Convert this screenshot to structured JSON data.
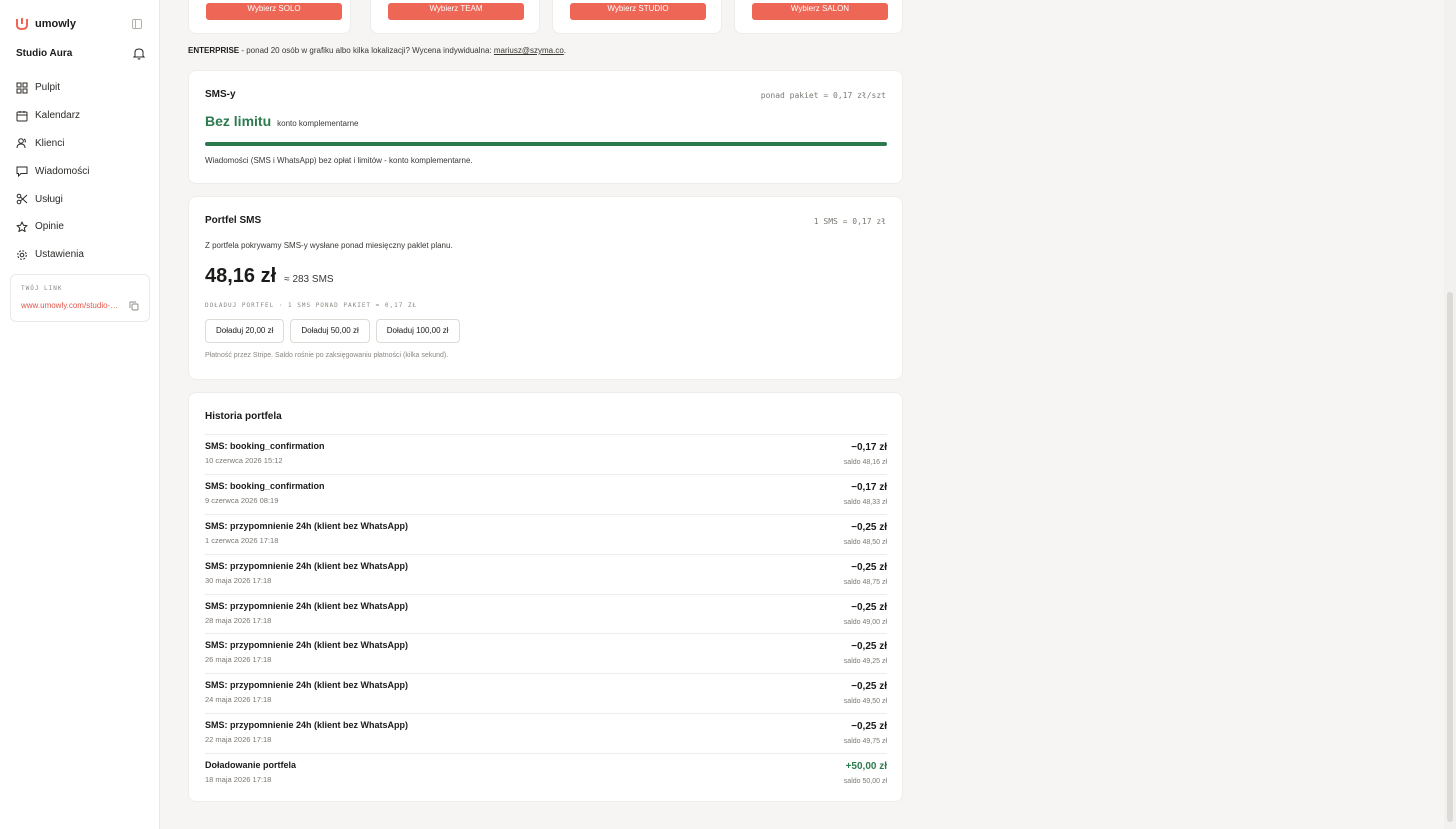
{
  "app": {
    "name": "umowly",
    "studio": "Studio Aura",
    "accent": "#ee6655",
    "success": "#2d7a4f"
  },
  "sidebar": {
    "items": [
      {
        "label": "Pulpit",
        "icon": "grid-icon"
      },
      {
        "label": "Kalendarz",
        "icon": "calendar-icon"
      },
      {
        "label": "Klienci",
        "icon": "users-icon"
      },
      {
        "label": "Wiadomości",
        "icon": "message-icon"
      },
      {
        "label": "Usługi",
        "icon": "scissors-icon"
      },
      {
        "label": "Opinie",
        "icon": "star-icon"
      },
      {
        "label": "Ustawienia",
        "icon": "gear-icon"
      }
    ],
    "link": {
      "label": "TWÓJ LINK",
      "url": "www.umowly.com/studio-aura"
    }
  },
  "plans": [
    "Wybierz SOLO",
    "Wybierz TEAM",
    "Wybierz STUDIO",
    "Wybierz SALON"
  ],
  "enterprise": {
    "label": "ENTERPRISE",
    "text": " - ponad 20 osób w grafiku albo kilka lokalizacji? Wycena indywidualna: ",
    "email": "mariusz@szyma.co",
    "end": "."
  },
  "sms": {
    "title": "SMS-y",
    "note": "ponad pakiet = 0,17 zł/szt",
    "status": "Bez limitu",
    "status_sub": "konto komplementarne",
    "usage_fraction": 1,
    "description": "Wiadomości (SMS i WhatsApp) bez opłat i limitów - konto komplementarne."
  },
  "wallet": {
    "title": "Portfel SMS",
    "note": "1 SMS = 0,17 zł",
    "description": "Z portfela pokrywamy SMS-y wysłane ponad miesięczny paklet planu.",
    "balance": "48,16 zł",
    "balance_sms": "≈ 283 SMS",
    "topup_label": "DOŁADUJ PORTFEL · 1 SMS PONAD PAKIET = 0,17 ZŁ",
    "topups": [
      "Doładuj 20,00 zł",
      "Doładuj 50,00 zł",
      "Doładuj 100,00 zł"
    ],
    "stripe_note": "Płatność przez Stripe. Saldo rośnie po zaksięgowaniu płatności (kilka sekund)."
  },
  "history": {
    "title": "Historia portfela",
    "rows": [
      {
        "title": "SMS: booking_confirmation",
        "date": "10 czerwca 2026 15:12",
        "amount": "−0,17 zł",
        "saldo": "saldo 48,16 zł"
      },
      {
        "title": "SMS: booking_confirmation",
        "date": "9 czerwca 2026 08:19",
        "amount": "−0,17 zł",
        "saldo": "saldo 48,33 zł"
      },
      {
        "title": "SMS: przypomnienie 24h (klient bez WhatsApp)",
        "date": "1 czerwca 2026 17:18",
        "amount": "−0,25 zł",
        "saldo": "saldo 48,50 zł"
      },
      {
        "title": "SMS: przypomnienie 24h (klient bez WhatsApp)",
        "date": "30 maja 2026 17:18",
        "amount": "−0,25 zł",
        "saldo": "saldo 48,75 zł"
      },
      {
        "title": "SMS: przypomnienie 24h (klient bez WhatsApp)",
        "date": "28 maja 2026 17:18",
        "amount": "−0,25 zł",
        "saldo": "saldo 49,00 zł"
      },
      {
        "title": "SMS: przypomnienie 24h (klient bez WhatsApp)",
        "date": "26 maja 2026 17:18",
        "amount": "−0,25 zł",
        "saldo": "saldo 49,25 zł"
      },
      {
        "title": "SMS: przypomnienie 24h (klient bez WhatsApp)",
        "date": "24 maja 2026 17:18",
        "amount": "−0,25 zł",
        "saldo": "saldo 49,50 zł"
      },
      {
        "title": "SMS: przypomnienie 24h (klient bez WhatsApp)",
        "date": "22 maja 2026 17:18",
        "amount": "−0,25 zł",
        "saldo": "saldo 49,75 zł"
      },
      {
        "title": "Doładowanie portfela",
        "date": "18 maja 2026 17:18",
        "amount": "+50,00 zł",
        "saldo": "saldo 50,00 zł",
        "positive": true
      }
    ]
  }
}
